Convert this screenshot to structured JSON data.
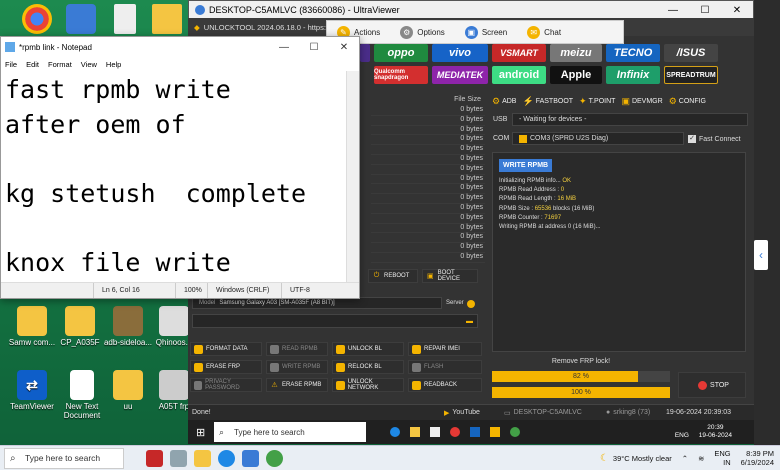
{
  "notepad": {
    "title": "*rpmb link - Notepad",
    "menu": [
      "File",
      "Edit",
      "Format",
      "View",
      "Help"
    ],
    "text": "fast rpmb write\nafter oem of\n\nkg stetush  complete\n\nknox file write",
    "status": {
      "position": "Ln 6, Col 16",
      "zoom": "100%",
      "eol": "Windows (CRLF)",
      "encoding": "UTF-8"
    }
  },
  "ultraviewer": {
    "title": "DESKTOP-C5AMLVC (83660086) - UltraViewer",
    "toolbar": [
      "Actions",
      "Options",
      "Screen",
      "Chat"
    ]
  },
  "unlocktool": {
    "title": "UNLOCKTOOL 2024.06.18.0 - https://u",
    "brands_row1": [
      "oppo",
      "vivo",
      "VSMART",
      "meizu",
      "TECNO",
      "/ISUS"
    ],
    "brands_row2": [
      "Qualcomm snapdragon",
      "MEDIATEK",
      "android",
      "Apple",
      "Infinix",
      "SPREADTRUM"
    ],
    "tabs": [
      "ADB",
      "FASTBOOT",
      "T.POINT",
      "DEVMGR",
      "CONFIG"
    ],
    "usb_label": "USB",
    "usb_value": "- Waiting for devices -",
    "com_label": "COM",
    "com_value": "COM3 (SPRD U2S Diag)",
    "fast_connect": "Fast Connect",
    "file_size_header": "File Size",
    "file_sizes": [
      "0 bytes",
      "0 bytes",
      "0 bytes",
      "0 bytes",
      "0 bytes",
      "0 bytes",
      "0 bytes",
      "0 bytes",
      "0 bytes",
      "0 bytes",
      "0 bytes",
      "0 bytes",
      "0 bytes",
      "0 bytes",
      "0 bytes",
      "0 bytes"
    ],
    "log_head": "WRITE RPMB",
    "log": [
      {
        "t": "Initializing RPMB info... ",
        "v": "OK"
      },
      {
        "t": "  RPMB Read Address : ",
        "v": "0"
      },
      {
        "t": "  RPMB Read Length : ",
        "v": "16 MiB"
      },
      {
        "t": "  RPMB Size : ",
        "v": "65536",
        "t2": " blocks (16 MiB)"
      },
      {
        "t": "  RPMB Counter : ",
        "v": "71697"
      },
      {
        "t": "Writing RPMB at address 0 (16 MiB)...",
        "v": ""
      }
    ],
    "reboot": "REBOOT",
    "boot_device": "BOOT DEVICE",
    "model_label": "Model",
    "model_value": "Samsung Galaxy A03 [SM-A035F (A8 BIT)]",
    "server_label": "Server",
    "buttons": {
      "format_data": "FORMAT DATA",
      "erase_frp": "ERASE FRP",
      "privacy_password": "PRIVACY PASSWORD",
      "read_rpmb": "READ RPMB",
      "write_rpmb": "WRITE RPMB",
      "erase_rpmb": "ERASE RPMB",
      "unlock_bl": "UNLOCK BL",
      "relock_bl": "RELOCK BL",
      "unlock_network": "UNLOCK NETWORK",
      "repair_imei": "REPAIR IMEI",
      "flash": "FLASH",
      "readback": "READBACK"
    },
    "progress_title": "Remove FRP lock!",
    "progress1": "82 %",
    "progress1_fraction": 0.82,
    "progress2": "100 %",
    "progress2_fraction": 1.0,
    "stop": "STOP",
    "status_left": "Done!",
    "status_youtube": "YouTube",
    "status_pc": "DESKTOP-C5AMLVC",
    "status_user": "srking8 (73)",
    "status_time": "19-06-2024 20:39:03"
  },
  "desktop_icons": [
    {
      "label": "Samw com..."
    },
    {
      "label": "CP_A035F"
    },
    {
      "label": "adb-sideloa..."
    },
    {
      "label": "Qhinoos..."
    },
    {
      "label": "TeamViewer"
    },
    {
      "label": "New Text Document"
    },
    {
      "label": "uu"
    },
    {
      "label": "A05T frp"
    }
  ],
  "inner_taskbar": {
    "search": "Type here to search",
    "lang": "ENG",
    "time": "20:39",
    "date": "19-06-2024"
  },
  "outer_taskbar": {
    "search": "Type here to search",
    "weather": "39°C  Mostly clear",
    "lang": "ENG",
    "lang2": "IN",
    "time": "8:39 PM",
    "date": "6/19/2024"
  }
}
